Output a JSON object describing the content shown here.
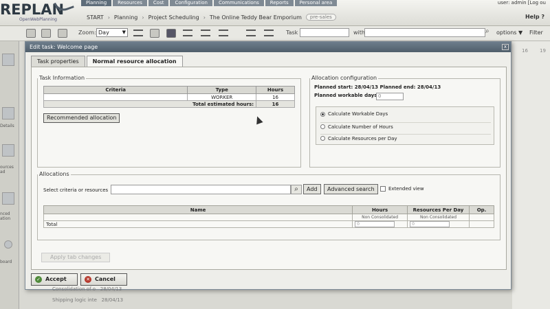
{
  "app": {
    "logo": "REPLAN",
    "logo_sub": "OpenWebPlanning",
    "nav_tabs": [
      "Planning",
      "Resources",
      "Cost",
      "Configuration",
      "Communications",
      "Reports",
      "Personal area"
    ],
    "user": "user: admin  [Log ou",
    "breadcrumb": [
      "START",
      "Planning",
      "Project Scheduling",
      "The Online Teddy Bear Emporium"
    ],
    "breadcrumb_badge": "pre-sales",
    "help": "Help"
  },
  "toolbar": {
    "zoom_label": "Zoom:",
    "zoom_value": "Day",
    "task_label": "Task",
    "with_label": "with",
    "options_label": "options",
    "filter_label": "Filter"
  },
  "sidebar": {
    "items": [
      "Details",
      "ources ad",
      "nced ation",
      "board"
    ]
  },
  "dialog": {
    "title": "Edit task: Welcome page",
    "close": "x",
    "tabs": [
      "Task properties",
      "Normal resource allocation"
    ],
    "task_info": {
      "legend": "Task Information",
      "columns": [
        "Criteria",
        "Type",
        "Hours"
      ],
      "rows": [
        {
          "criteria": "",
          "type": "WORKER",
          "hours": "16"
        }
      ],
      "total_label": "Total estimated hours:",
      "total_value": "16",
      "recommended_button": "Recommended allocation"
    },
    "alloc_config": {
      "legend": "Allocation configuration",
      "planned_start_label": "Planned start:",
      "planned_start": "28/04/13",
      "planned_end_label": "Planned end:",
      "planned_end": "28/04/13",
      "workable_days_label": "Planned workable days:",
      "workable_days": "0",
      "options": [
        {
          "label": "Calculate Workable Days",
          "checked": true
        },
        {
          "label": "Calculate Number of Hours",
          "checked": false
        },
        {
          "label": "Calculate Resources per Day",
          "checked": false
        }
      ]
    },
    "allocations": {
      "legend": "Allocations",
      "criteria_label": "Select criteria or resources",
      "add_button": "Add",
      "advanced_button": "Advanced search",
      "extended_view_label": "Extended view",
      "columns": [
        "Name",
        "Hours",
        "Resources Per Day",
        "Op."
      ],
      "sub_hours": "Non Consolidated",
      "sub_resources": "Non Consolidated",
      "total_label": "Total",
      "total_hours": "0",
      "total_resources": "0"
    },
    "apply_button": "Apply tab changes",
    "accept_button": "Accept",
    "cancel_button": "Cancel"
  },
  "background": {
    "rows": [
      {
        "label": "Consolidation of o",
        "date": "28/04/13"
      },
      {
        "label": "Shipping logic inte",
        "date": "28/04/13"
      }
    ],
    "gantt_header": [
      "16",
      "19"
    ]
  }
}
